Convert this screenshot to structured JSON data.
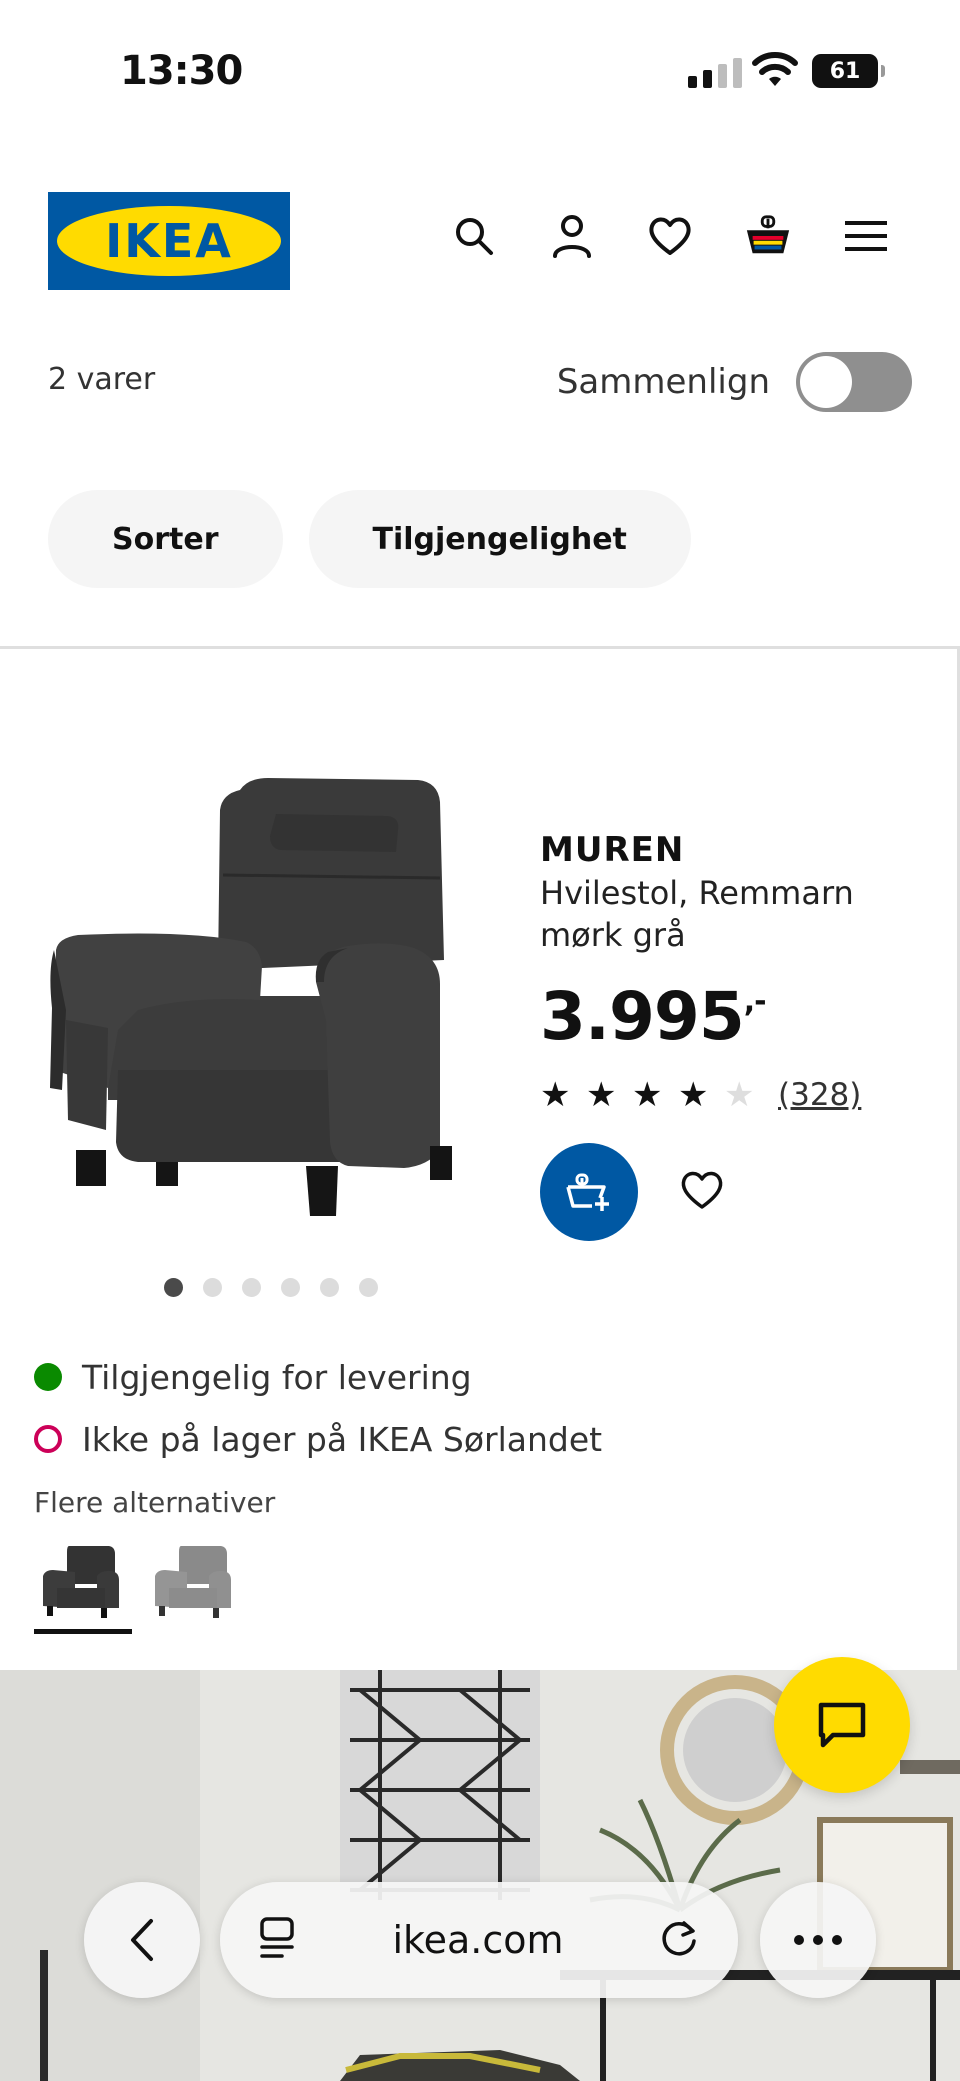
{
  "status_bar": {
    "time": "13:30",
    "battery": "61"
  },
  "header": {
    "logo_text": "IKEA",
    "icons": [
      "search-icon",
      "user-icon",
      "heart-icon",
      "basket-icon",
      "menu-icon"
    ]
  },
  "toolbar": {
    "item_count": "2 varer",
    "compare_label": "Sammenlign",
    "compare_on": false
  },
  "filters": [
    {
      "label": "Sorter"
    },
    {
      "label": "Tilgjengelighet"
    }
  ],
  "product": {
    "name": "MUREN",
    "description": "Hvilestol, Remmarn mørk grå",
    "price": "3.995",
    "price_suffix": ",-",
    "rating": 4,
    "rating_max": 5,
    "review_count": "(328)",
    "image_count": 6,
    "active_image": 1,
    "availability": [
      {
        "text": "Tilgjengelig for levering",
        "status": "available",
        "color": "#0a8a00"
      },
      {
        "text": "Ikke på lager på IKEA Sørlandet",
        "status": "out-of-stock",
        "color": "#cc0058"
      }
    ],
    "more_options_label": "Flere alternativer",
    "variants": [
      {
        "color": "#333333",
        "selected": true
      },
      {
        "color": "#8c8c8c",
        "selected": false
      }
    ]
  },
  "browser": {
    "url": "ikea.com"
  },
  "colors": {
    "brand_blue": "#0058a3",
    "brand_yellow": "#ffdb00"
  }
}
